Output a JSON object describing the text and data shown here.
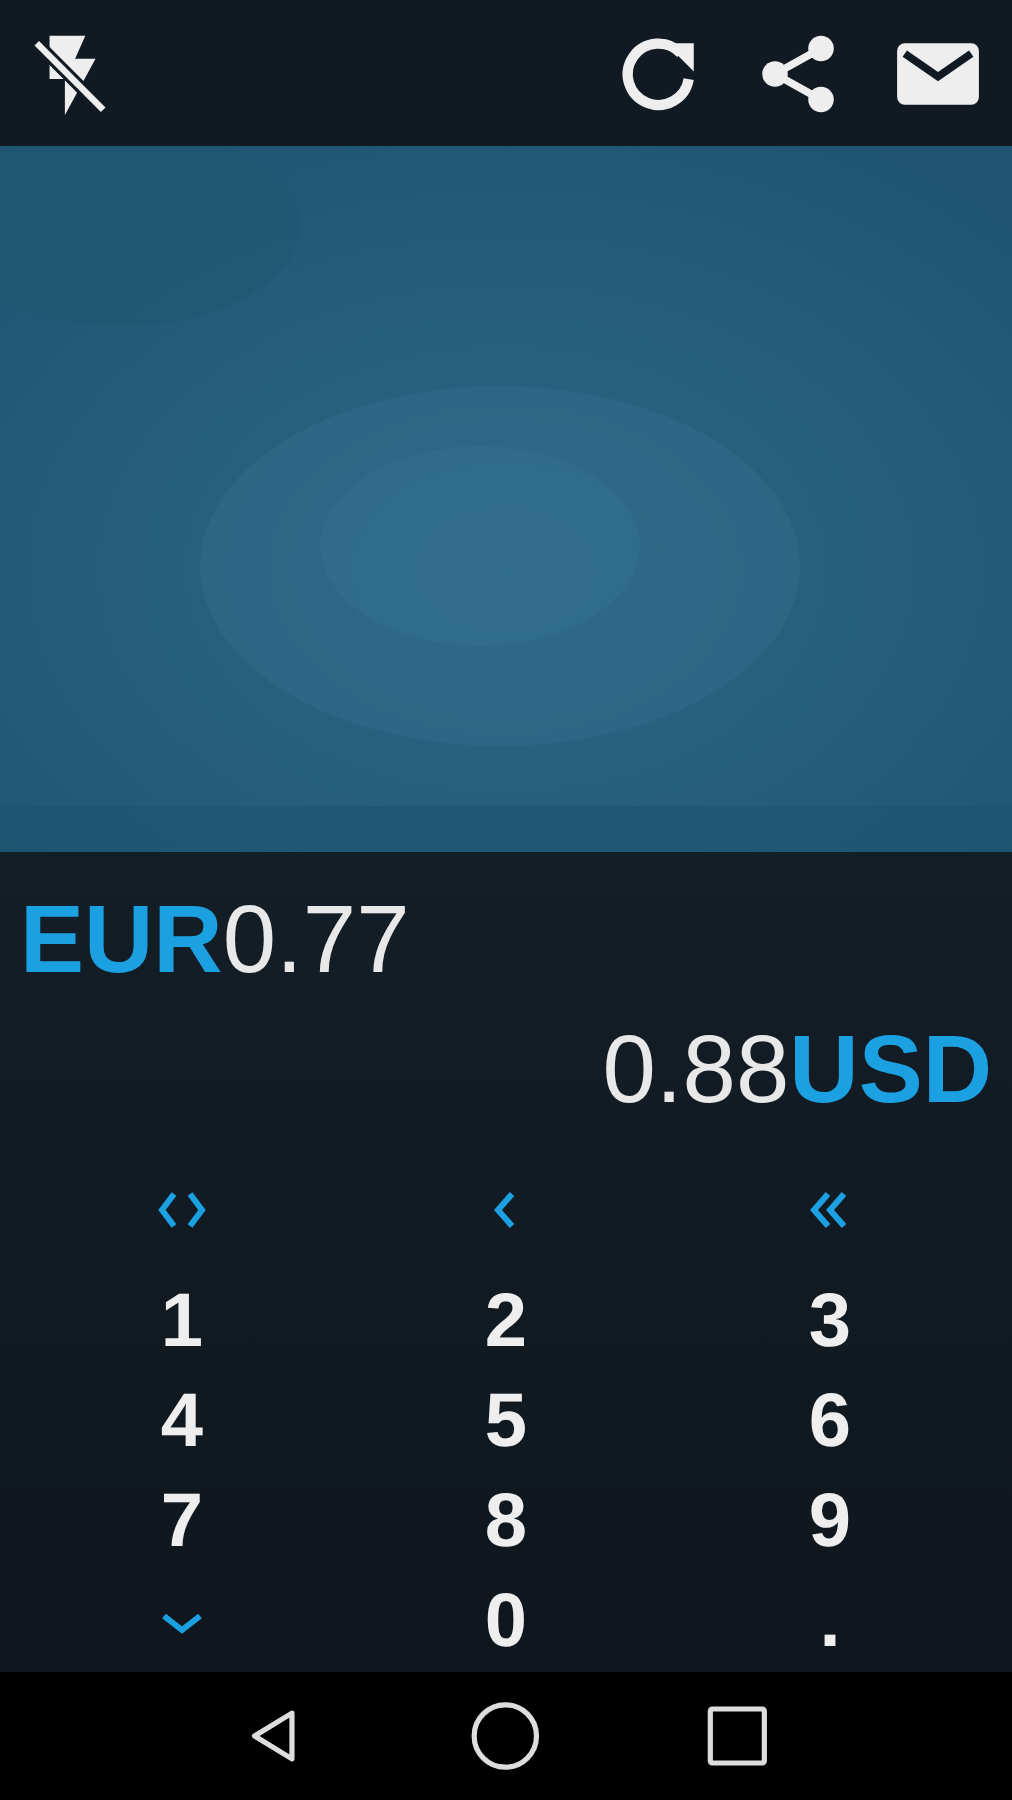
{
  "toolbar": {
    "actions": [
      {
        "kind": "flash-off"
      },
      {
        "kind": "refresh"
      },
      {
        "kind": "share"
      },
      {
        "kind": "mail"
      }
    ]
  },
  "source": {
    "currency": "EUR",
    "amount": "0.77"
  },
  "target": {
    "amount": "0.88",
    "currency": "USD"
  },
  "keypad": [
    {
      "kind": "swap"
    },
    {
      "kind": "back"
    },
    {
      "kind": "clear"
    },
    {
      "kind": "digit",
      "label": "1"
    },
    {
      "kind": "digit",
      "label": "2"
    },
    {
      "kind": "digit",
      "label": "3"
    },
    {
      "kind": "digit",
      "label": "4"
    },
    {
      "kind": "digit",
      "label": "5"
    },
    {
      "kind": "digit",
      "label": "6"
    },
    {
      "kind": "digit",
      "label": "7"
    },
    {
      "kind": "digit",
      "label": "8"
    },
    {
      "kind": "digit",
      "label": "9"
    },
    {
      "kind": "down"
    },
    {
      "kind": "digit",
      "label": "0"
    },
    {
      "kind": "digit",
      "label": "."
    }
  ],
  "navigation": [
    {
      "kind": "back"
    },
    {
      "kind": "home"
    },
    {
      "kind": "recents"
    }
  ]
}
